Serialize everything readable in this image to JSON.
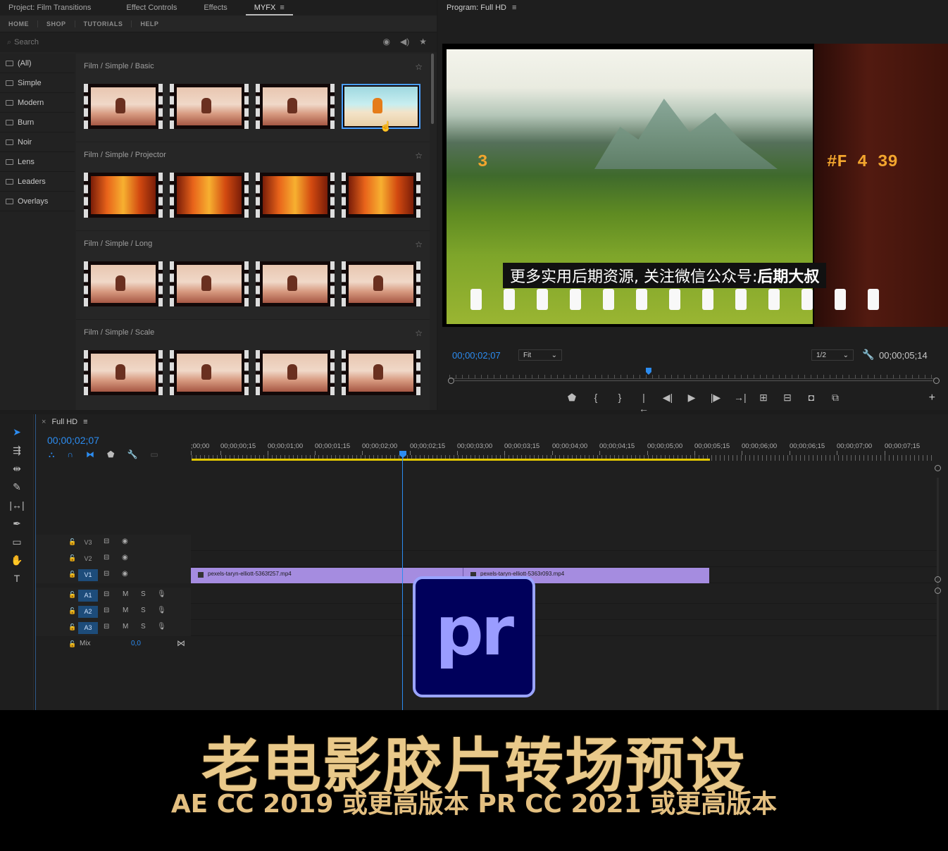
{
  "top_tabs": [
    {
      "label": "Project: Film Transitions"
    },
    {
      "label": "Effect Controls"
    },
    {
      "label": "Effects"
    },
    {
      "label": "MYFX",
      "active": true
    }
  ],
  "menu_glyph": "≡",
  "nav": [
    "HOME",
    "SHOP",
    "TUTORIALS",
    "HELP"
  ],
  "search": {
    "placeholder": "Search"
  },
  "categories": [
    "(All)",
    "Simple",
    "Modern",
    "Burn",
    "Noir",
    "Lens",
    "Leaders",
    "Overlays"
  ],
  "groups": [
    {
      "title": "Film / Simple / Basic",
      "style": "basic",
      "selected_index": 3
    },
    {
      "title": "Film / Simple / Projector",
      "style": "projector"
    },
    {
      "title": "Film / Simple / Long",
      "style": "basic"
    },
    {
      "title": "Film / Simple / Scale",
      "style": "basic"
    }
  ],
  "program": {
    "title": "Program: Full HD",
    "film_left_number": "3",
    "film_right_number": "#F 4 39",
    "subtitle_normal": "更多实用后期资源, 关注微信公众号:",
    "subtitle_bold": "后期大叔",
    "current_tc": "00;00;02;07",
    "fit": "Fit",
    "resolution": "1/2",
    "duration_tc": "00;00;05;14",
    "playhead_fraction": 0.41
  },
  "transport_icons": [
    "marker-icon",
    "mark-in-icon",
    "mark-out-icon",
    "go-to-in-icon",
    "step-back-icon",
    "play-icon",
    "step-forward-icon",
    "go-to-out-icon",
    "lift-icon",
    "extract-icon",
    "export-frame-icon",
    "compare-icon"
  ],
  "tools": [
    "selection-tool",
    "track-select-tool",
    "ripple-edit-tool",
    "razor-tool",
    "slip-tool",
    "pen-tool",
    "rectangle-tool",
    "hand-tool",
    "type-tool"
  ],
  "timeline": {
    "sequence": "Full HD",
    "tc": "00;00;02;07",
    "ticks": [
      ";00;00",
      "00;00;00;15",
      "00;00;01;00",
      "00;00;01;15",
      "00;00;02;00",
      "00;00;02;15",
      "00;00;03;00",
      "00;00;03;15",
      "00;00;04;00",
      "00;00;04;15",
      "00;00;05;00",
      "00;00;05;15",
      "00;00;06;00",
      "00;00;06;15",
      "00;00;07;00",
      "00;00;07;15"
    ],
    "video_tracks": [
      "V3",
      "V2",
      "V1"
    ],
    "audio_tracks": [
      "A1",
      "A2",
      "A3"
    ],
    "mix_label": "Mix",
    "mix_value": "0,0",
    "clips": [
      {
        "name": "pexels-taryn-elliott-5363f257.mp4"
      },
      {
        "name": "pexels-taryn-elliott-5363r093.mp4"
      }
    ],
    "audio_m": "M",
    "audio_s": "S"
  },
  "logo_text": "pr",
  "banner": {
    "title": "老电影胶片转场预设",
    "subtitle": "AE CC 2019 或更高版本 PR CC 2021 或更高版本"
  },
  "colors": {
    "accent": "#2c8cf0",
    "clip": "#a58ce0",
    "workarea": "#e3c800",
    "gold": "#e9c98a"
  }
}
